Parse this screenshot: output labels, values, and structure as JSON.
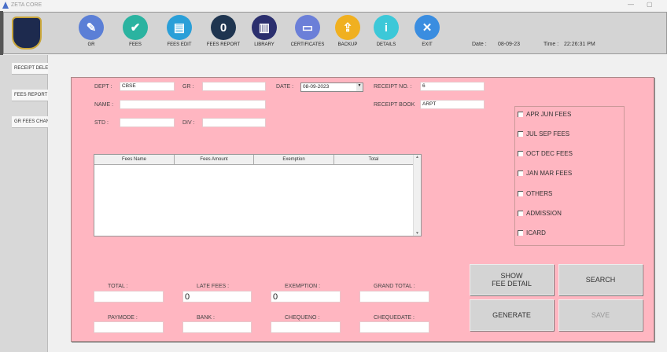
{
  "window": {
    "title": "ZETA CORE",
    "minimize": "—",
    "restore": "▢"
  },
  "toolbar": {
    "items": [
      {
        "label": "GR",
        "icon": "pencil-icon",
        "color": "#5b7fd6",
        "glyph": "✎"
      },
      {
        "label": "FEES",
        "icon": "fees-check-icon",
        "color": "#2bb3a0",
        "glyph": "✔"
      },
      {
        "label": "FEES EDIT",
        "icon": "document-edit-icon",
        "color": "#2a9fd8",
        "glyph": "▤"
      },
      {
        "label": "FEES REPORT",
        "icon": "report-icon",
        "color": "#1f3550",
        "glyph": "0"
      },
      {
        "label": "LIBRARY",
        "icon": "books-icon",
        "color": "#2b2f6e",
        "glyph": "▥"
      },
      {
        "label": "CERTIFICATES",
        "icon": "certificate-icon",
        "color": "#6b7fd8",
        "glyph": "▭"
      },
      {
        "label": "BACKUP",
        "icon": "backup-icon",
        "color": "#f0b020",
        "glyph": "⇪"
      },
      {
        "label": "DETAILS",
        "icon": "info-icon",
        "color": "#3cc8d8",
        "glyph": "i"
      },
      {
        "label": "EXIT",
        "icon": "close-icon",
        "color": "#3a8de0",
        "glyph": "✕"
      }
    ],
    "date_label": "Date :",
    "date_value": "08-09-23",
    "time_label": "Time :",
    "time_value": "22:26:31 PM"
  },
  "sidebar": {
    "items": [
      "RECEIPT DELETE",
      "FEES REPORT",
      "GR FEES CHANGE"
    ]
  },
  "form": {
    "dept_label": "DEPT :",
    "dept_value": "CBSE",
    "gr_label": "GR :",
    "gr_value": "",
    "date_label": "DATE :",
    "date_value": "08-09-2023",
    "receipt_no_label": "RECEIPT NO. :",
    "receipt_no_value": "6",
    "name_label": "NAME :",
    "name_value": "",
    "receipt_book_label": "RECEIPT BOOK",
    "receipt_book_value": "ARPT",
    "std_label": "STD :",
    "std_value": "",
    "div_label": "DIV :",
    "div_value": ""
  },
  "grid": {
    "columns": [
      "Fees Name",
      "Fees Amount",
      "Exemption",
      "Total"
    ],
    "rows": []
  },
  "checkboxes": [
    {
      "label": "APR JUN FEES",
      "checked": false
    },
    {
      "label": "JUL SEP FEES",
      "checked": false
    },
    {
      "label": "OCT DEC FEES",
      "checked": false
    },
    {
      "label": "JAN MAR FEES",
      "checked": false
    },
    {
      "label": "OTHERS",
      "checked": false
    },
    {
      "label": "ADMISSION",
      "checked": false
    },
    {
      "label": "ICARD",
      "checked": false
    }
  ],
  "totals": {
    "total_label": "TOTAL :",
    "total_value": "",
    "late_fees_label": "LATE FEES :",
    "late_fees_value": "0",
    "exemption_label": "EXEMPTION :",
    "exemption_value": "0",
    "grand_total_label": "GRAND TOTAL :",
    "grand_total_value": "",
    "paymode_label": "PAYMODE :",
    "paymode_value": "",
    "bank_label": "BANK :",
    "bank_value": "",
    "chequeno_label": "CHEQUENO :",
    "chequeno_value": "",
    "chequedate_label": "CHEQUEDATE :",
    "chequedate_value": ""
  },
  "buttons": {
    "show_fee_detail": "SHOW\nFEE DETAIL",
    "search": "SEARCH",
    "generate": "GENERATE",
    "save": "SAVE"
  },
  "colors": {
    "panel": "#ffb6c1",
    "toolbar": "#d4d4d4"
  }
}
